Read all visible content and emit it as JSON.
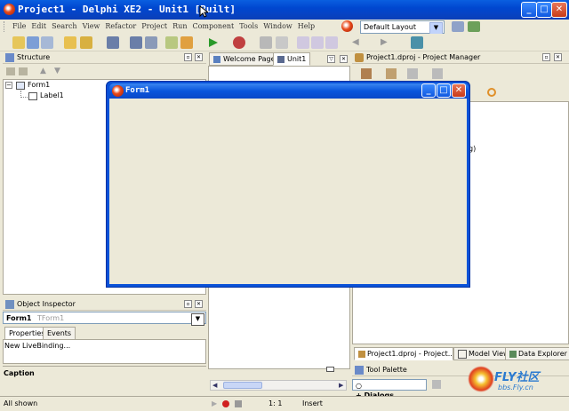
{
  "window": {
    "title": "Project1 - Delphi XE2 - Unit1 [Built]"
  },
  "menu": [
    "File",
    "Edit",
    "Search",
    "View",
    "Refactor",
    "Project",
    "Run",
    "Component",
    "Tools",
    "Window",
    "Help"
  ],
  "layout_combo": {
    "value": "Default Layout"
  },
  "structure": {
    "title": "Structure",
    "tree": {
      "root": "Form1",
      "child": "Label1"
    }
  },
  "editor_tabs": [
    "Welcome Page",
    "Unit1"
  ],
  "project_manager": {
    "title": "Project1.dproj - Project Manager",
    "partial_text": "g)"
  },
  "form1": {
    "title": "Form1"
  },
  "object_inspector": {
    "title": "Object Inspector",
    "selected_name": "Form1",
    "selected_type": "TForm1",
    "tabs": [
      "Properties",
      "Events"
    ],
    "livebinding": "New LiveBinding...",
    "caption_label": "Caption"
  },
  "bottom_tabs": [
    "Project1.dproj - Project...",
    "Model View",
    "Data Explorer"
  ],
  "tool_palette": {
    "title": "Tool Palette",
    "section": "Dialogs"
  },
  "status": {
    "left": "All shown",
    "position": "1:  1",
    "mode": "Insert"
  },
  "watermark": {
    "line1": "FLY社区",
    "line2": "bbs.Fly.cn"
  },
  "colors": {
    "titlebar": "#0047d0",
    "form_bg": "#ece9d8",
    "accent": "#0a52d8"
  }
}
